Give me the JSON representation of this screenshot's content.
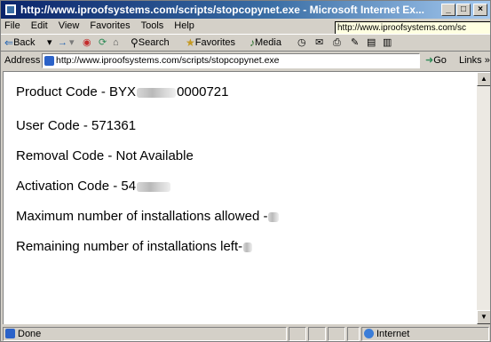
{
  "window": {
    "title": "http://www.iproofsystems.com/scripts/stopcopynet.exe - Microsoft Internet Ex..."
  },
  "menu": {
    "items": [
      "File",
      "Edit",
      "View",
      "Favorites",
      "Tools",
      "Help"
    ]
  },
  "tooltip": {
    "url": "http://www.iproofsystems.com/sc"
  },
  "toolbar": {
    "back_label": "Back",
    "search_label": "Search",
    "favorites_label": "Favorites",
    "media_label": "Media"
  },
  "address": {
    "label": "Address",
    "url": "http://www.iproofsystems.com/scripts/stopcopynet.exe",
    "go_label": "Go",
    "links_label": "Links"
  },
  "content": {
    "product_code_label": "Product Code - BYX",
    "product_code_suffix": "0000721",
    "user_code": "User Code - 571361",
    "removal_code": "Removal Code - Not Available",
    "activation_code_label": "Activation Code - 54",
    "max_installs_label": "Maximum number of installations allowed -",
    "remaining_installs_label": "Remaining number of installations left-"
  },
  "status": {
    "text": "Done",
    "zone": "Internet"
  },
  "colors": {
    "title_gradient_start": "#0a246a",
    "title_gradient_end": "#a6caf0",
    "chrome": "#d4d0c8",
    "tooltip_bg": "#ffffe1"
  }
}
